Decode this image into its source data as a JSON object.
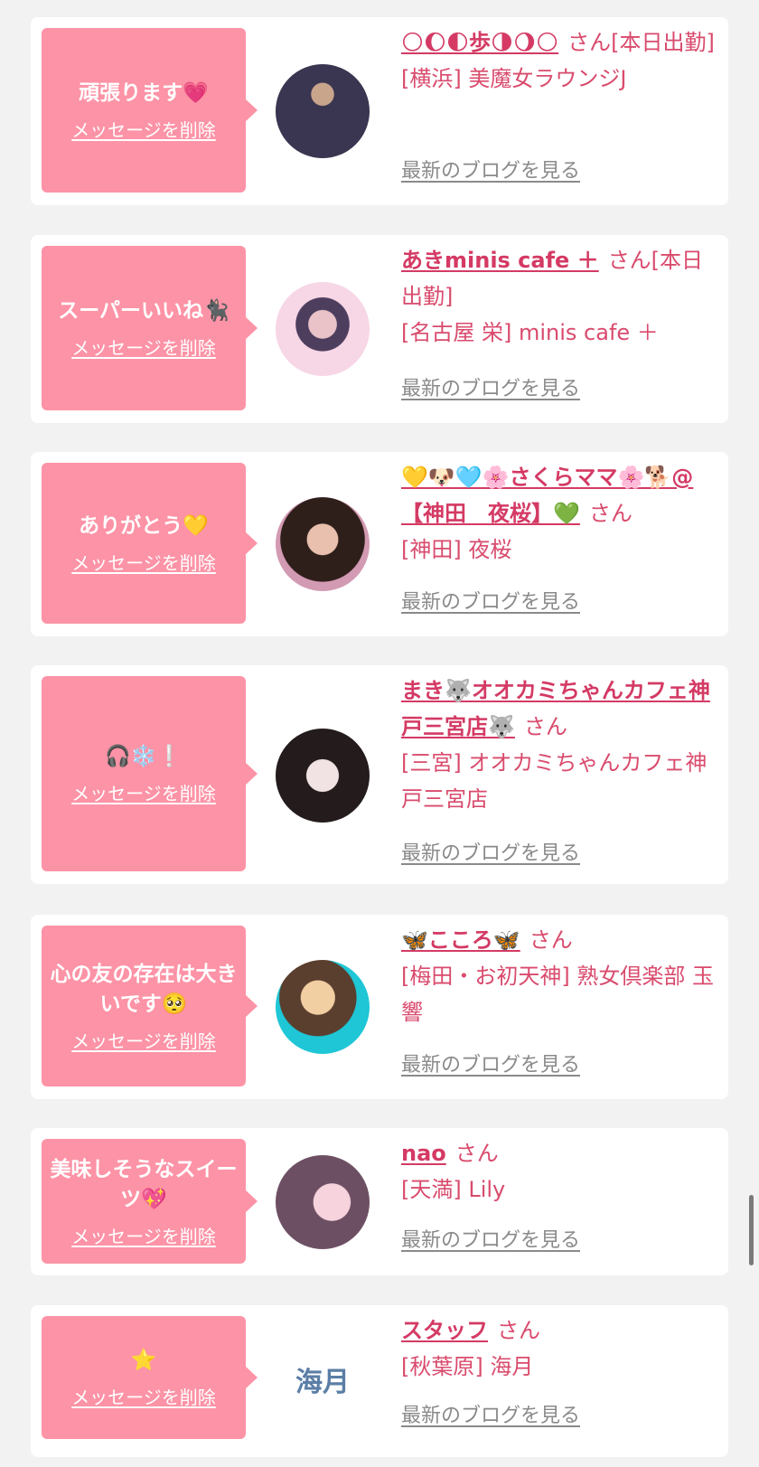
{
  "entries": [
    {
      "message": "頑張ります💗",
      "delete_label": "メッセージを削除",
      "user_name": "🌕🌔🌓歩🌗🌖🌕",
      "honorific": "さん[本日出勤]",
      "shop": "[横浜] 美魔女ラウンジJ",
      "blog_label": "最新のブログを見る",
      "avatar_colors": [
        "#1b1e2e",
        "#5a4d6e"
      ]
    },
    {
      "message": "スーパーいいね🐈‍⬛",
      "delete_label": "メッセージを削除",
      "user_name": "あきminis cafe ＋",
      "honorific": "さん[本日出勤]",
      "shop": "[名古屋 栄] minis cafe ＋",
      "blog_label": "最新のブログを見る",
      "avatar_colors": [
        "#f6c7d8",
        "#8c7a9e"
      ]
    },
    {
      "message": "ありがとう💛",
      "delete_label": "メッセージを削除",
      "user_name": "💛🐶🩵🌸さくらママ🌸🐕@【神田　夜桜】💚",
      "honorific": "さん",
      "shop": "[神田] 夜桜",
      "blog_label": "最新のブログを見る",
      "avatar_colors": [
        "#3a2620",
        "#d9a58d"
      ]
    },
    {
      "message": "🎧❄️❕",
      "delete_label": "メッセージを削除",
      "user_name": "まき🐺オオカミちゃんカフェ神戸三宮店🐺",
      "honorific": "さん",
      "shop": "[三宮] オオカミちゃんカフェ神戸三宮店",
      "blog_label": "最新のブログを見る",
      "avatar_colors": [
        "#e6dede",
        "#2b2222"
      ]
    },
    {
      "message": "心の友の存在は大きいです🥺",
      "delete_label": "メッセージを削除",
      "user_name": "🦋こころ🦋",
      "honorific": "さん",
      "shop": "[梅田・お初天神] 熟女倶楽部 玉響",
      "blog_label": "最新のブログを見る",
      "avatar_colors": [
        "#5a3e2e",
        "#1ec6d6"
      ]
    },
    {
      "message": "美味しそうなスイーツ💖",
      "delete_label": "メッセージを削除",
      "user_name": "nao",
      "honorific": "さん",
      "shop": "[天満] Lily",
      "blog_label": "最新のブログを見る",
      "avatar_colors": [
        "#6d4f63",
        "#f3c5d4"
      ]
    },
    {
      "message": "⭐",
      "delete_label": "メッセージを削除",
      "user_name": "スタッフ",
      "honorific": "さん",
      "shop": "[秋葉原] 海月",
      "blog_label": "最新のブログを見る",
      "avatar_logo_text": "海月"
    }
  ]
}
